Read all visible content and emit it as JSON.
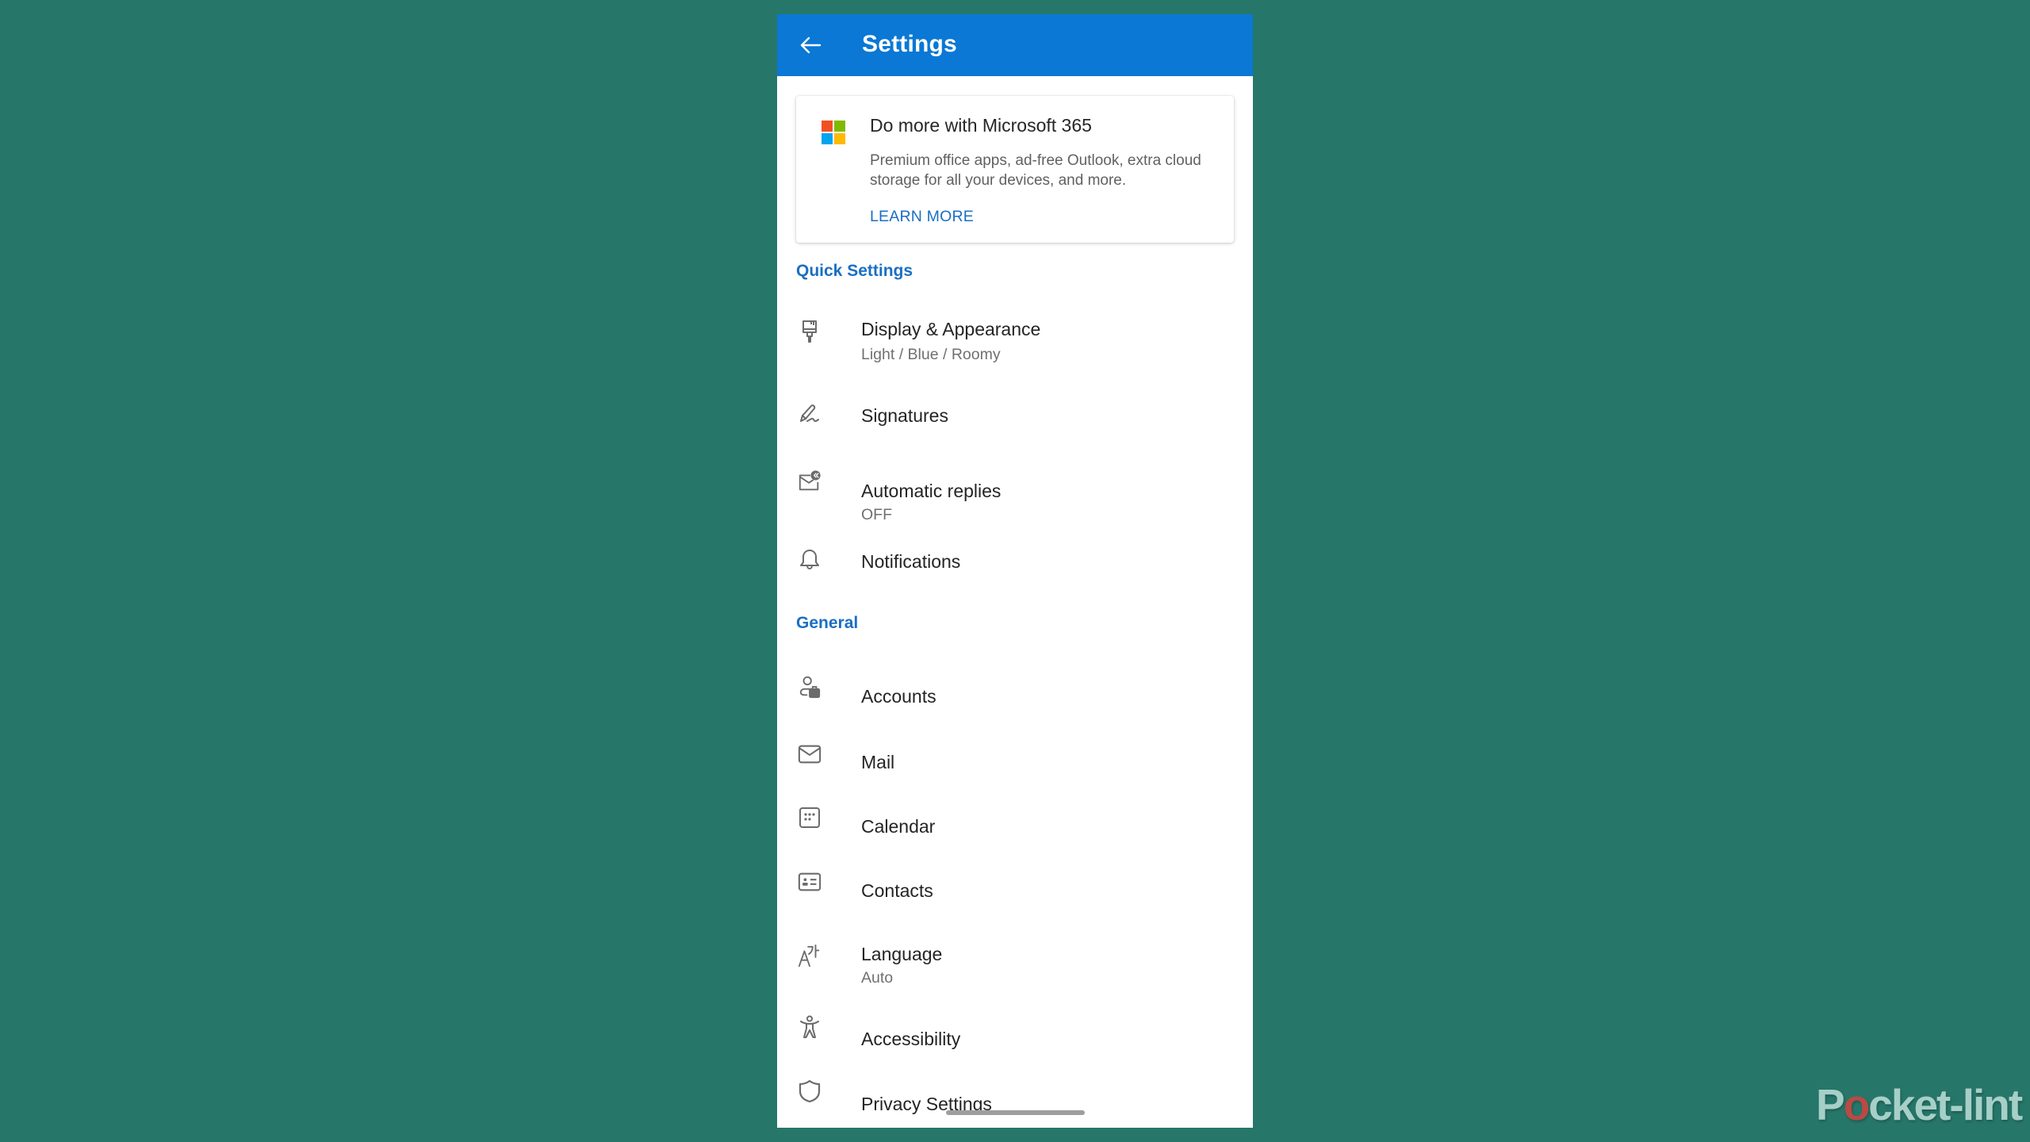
{
  "colors": {
    "background": "#26776a",
    "appbar": "#0a78d4",
    "accent": "#1a6fc4",
    "icon": "#6b6b6b",
    "text_primary": "#242424",
    "text_secondary": "#707070"
  },
  "appbar": {
    "back_icon": "arrow-left-icon",
    "title": "Settings"
  },
  "promo": {
    "logo_icon": "microsoft-logo-icon",
    "logo_colors": [
      "#f25022",
      "#7fba00",
      "#00a4ef",
      "#ffb900"
    ],
    "title": "Do more with Microsoft 365",
    "body": "Premium office apps, ad-free Outlook, extra cloud storage for all your devices, and more.",
    "action": "LEARN MORE"
  },
  "sections": [
    {
      "header": "Quick Settings",
      "items": [
        {
          "icon": "paintbrush-icon",
          "title": "Display & Appearance",
          "subtitle": "Light / Blue / Roomy"
        },
        {
          "icon": "signature-icon",
          "title": "Signatures"
        },
        {
          "icon": "auto-reply-icon",
          "title": "Automatic replies",
          "subtitle": "OFF"
        },
        {
          "icon": "bell-icon",
          "title": "Notifications"
        }
      ]
    },
    {
      "header": "General",
      "items": [
        {
          "icon": "account-briefcase-icon",
          "title": "Accounts"
        },
        {
          "icon": "mail-icon",
          "title": "Mail"
        },
        {
          "icon": "calendar-icon",
          "title": "Calendar"
        },
        {
          "icon": "contact-card-icon",
          "title": "Contacts"
        },
        {
          "icon": "language-icon",
          "title": "Language",
          "subtitle": "Auto"
        },
        {
          "icon": "accessibility-icon",
          "title": "Accessibility"
        },
        {
          "icon": "shield-icon",
          "title": "Privacy Settings"
        }
      ]
    }
  ],
  "watermark": {
    "prefix": "P",
    "power_glyph": "o",
    "suffix": "cket-lint"
  }
}
